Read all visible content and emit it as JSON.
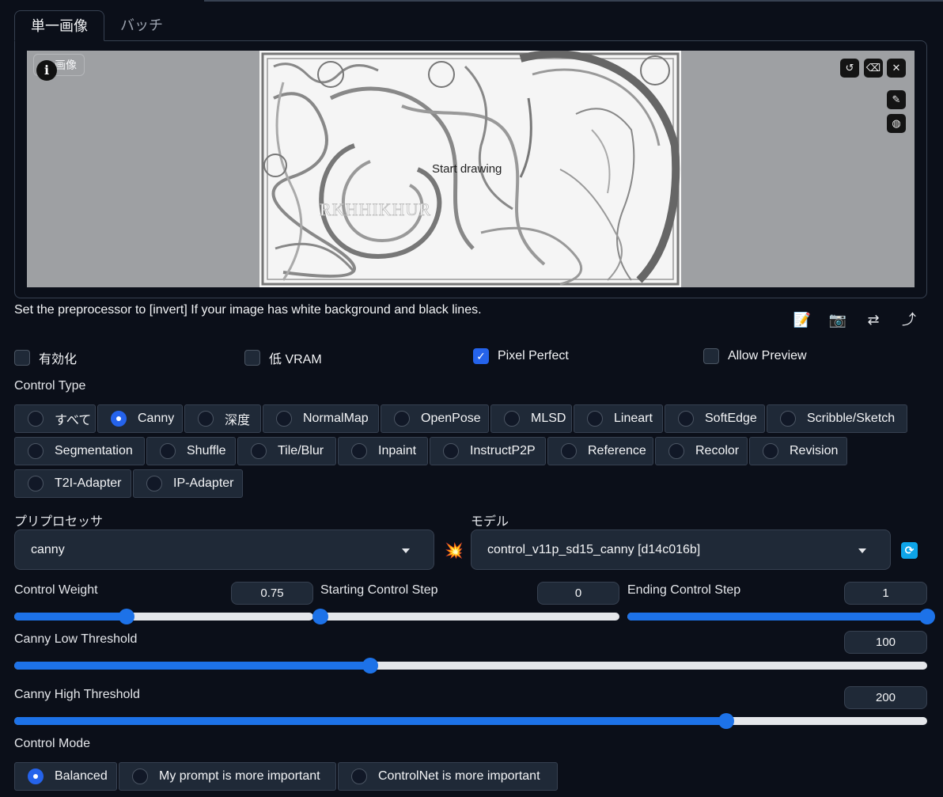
{
  "tabs": [
    "単一画像",
    "バッチ"
  ],
  "canvas": {
    "image_label": "画像",
    "placeholder": "Start drawing",
    "art_text": "RKHHIKHUR"
  },
  "hint": "Set the preprocessor to [invert] If your image has white background and black lines.",
  "checkboxes": [
    {
      "label": "有効化",
      "checked": false
    },
    {
      "label": "低 VRAM",
      "checked": false
    },
    {
      "label": "Pixel Perfect",
      "checked": true
    },
    {
      "label": "Allow Preview",
      "checked": false
    }
  ],
  "control_type": {
    "label": "Control Type",
    "options": [
      "すべて",
      "Canny",
      "深度",
      "NormalMap",
      "OpenPose",
      "MLSD",
      "Lineart",
      "SoftEdge",
      "Scribble/Sketch",
      "Segmentation",
      "Shuffle",
      "Tile/Blur",
      "Inpaint",
      "InstructP2P",
      "Reference",
      "Recolor",
      "Revision",
      "T2I-Adapter",
      "IP-Adapter"
    ],
    "selected": "Canny"
  },
  "preprocessor": {
    "label": "プリプロセッサ",
    "value": "canny"
  },
  "model": {
    "label": "モデル",
    "value": "control_v11p_sd15_canny [d14c016b]"
  },
  "sliders": {
    "weight": {
      "label": "Control Weight",
      "value": "0.75",
      "min": 0,
      "max": 2,
      "fraction": 0.375
    },
    "start": {
      "label": "Starting Control Step",
      "value": "0",
      "min": 0,
      "max": 1,
      "fraction": 0
    },
    "end": {
      "label": "Ending Control Step",
      "value": "1",
      "min": 0,
      "max": 1,
      "fraction": 1
    },
    "low": {
      "label": "Canny Low Threshold",
      "value": "100",
      "min": 1,
      "max": 255,
      "fraction": 0.39
    },
    "high": {
      "label": "Canny High Threshold",
      "value": "200",
      "min": 1,
      "max": 255,
      "fraction": 0.78
    }
  },
  "control_mode": {
    "label": "Control Mode",
    "options": [
      "Balanced",
      "My prompt is more important",
      "ControlNet is more important"
    ],
    "selected": "Balanced"
  },
  "colors": {
    "accent": "#1d72e8",
    "background": "#0b0f19",
    "panel": "#1f2937",
    "border": "#374151"
  }
}
